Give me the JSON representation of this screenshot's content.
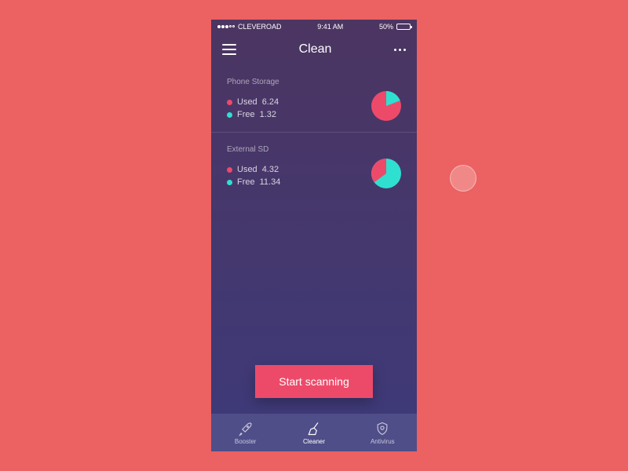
{
  "status": {
    "carrier": "CLEVEROAD",
    "time": "9:41 AM",
    "battery_pct": "50%"
  },
  "nav": {
    "title": "Clean"
  },
  "colors": {
    "used": "#ed4a6a",
    "free": "#2fe0d0"
  },
  "storage": [
    {
      "label": "Phone Storage",
      "used_label": "Used",
      "used_value": "6.24",
      "free_label": "Free",
      "free_value": "1.32"
    },
    {
      "label": "External SD",
      "used_label": "Used",
      "used_value": "4.32",
      "free_label": "Free",
      "free_value": "11.34"
    }
  ],
  "cta": {
    "label": "Start scanning"
  },
  "tabs": [
    {
      "label": "Booster"
    },
    {
      "label": "Cleaner"
    },
    {
      "label": "Antivirus"
    }
  ],
  "chart_data": [
    {
      "type": "pie",
      "title": "Phone Storage",
      "series": [
        {
          "name": "Used",
          "value": 6.24,
          "color": "#ed4a6a"
        },
        {
          "name": "Free",
          "value": 1.32,
          "color": "#2fe0d0"
        }
      ]
    },
    {
      "type": "pie",
      "title": "External SD",
      "series": [
        {
          "name": "Used",
          "value": 4.32,
          "color": "#ed4a6a"
        },
        {
          "name": "Free",
          "value": 11.34,
          "color": "#2fe0d0"
        }
      ]
    }
  ]
}
